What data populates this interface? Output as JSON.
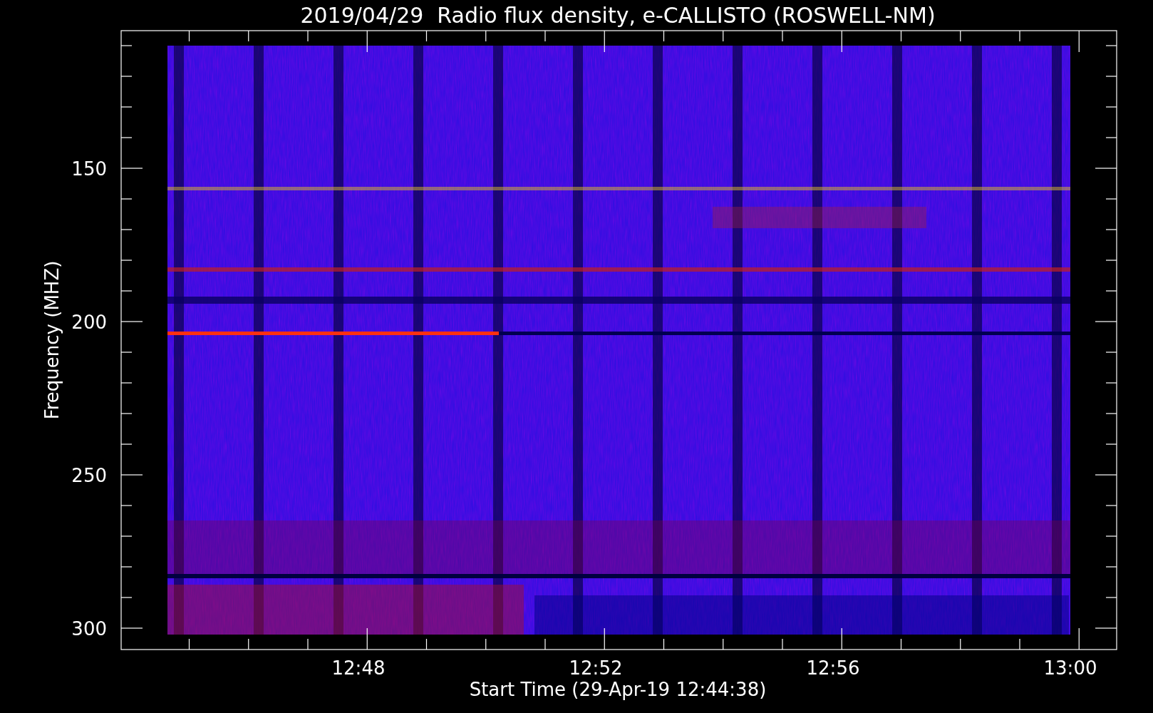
{
  "title": "2019/04/29  Radio flux density, e-CALLISTO (ROSWELL-NM)",
  "y_axis": {
    "label": "Frequency (MHZ)",
    "ticks": [
      "150",
      "200",
      "250",
      "300"
    ]
  },
  "x_axis": {
    "label": "Start Time (29-Apr-19 12:44:38)",
    "ticks": [
      "12:48",
      "12:52",
      "12:56",
      "13:00"
    ]
  }
}
